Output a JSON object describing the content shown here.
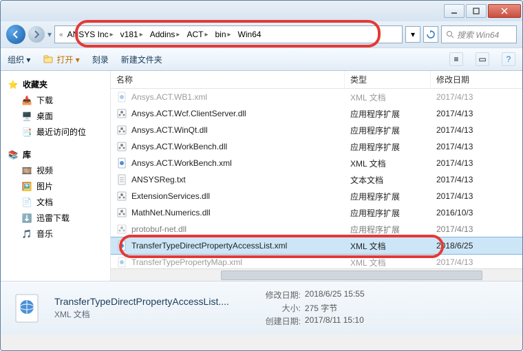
{
  "breadcrumb": {
    "prefix": "«",
    "segments": [
      "ANSYS Inc",
      "v181",
      "Addins",
      "ACT",
      "bin",
      "Win64"
    ]
  },
  "search": {
    "placeholder": "搜索 Win64"
  },
  "toolbar": {
    "organize": "组织 ▾",
    "open": "打开 ▾",
    "burn": "刻录",
    "newfolder": "新建文件夹"
  },
  "sidebar": {
    "favorites": {
      "label": "收藏夹",
      "items": [
        "下载",
        "桌面",
        "最近访问的位"
      ]
    },
    "libraries": {
      "label": "库",
      "items": [
        "视频",
        "图片",
        "文档",
        "迅雷下载",
        "音乐"
      ]
    }
  },
  "columns": {
    "name": "名称",
    "type": "类型",
    "date": "修改日期"
  },
  "files": [
    {
      "icon": "xml",
      "name": "Ansys.ACT.WB1.xml",
      "type": "XML 文档",
      "date": "2017/4/13",
      "dim": true
    },
    {
      "icon": "dll",
      "name": "Ansys.ACT.Wcf.ClientServer.dll",
      "type": "应用程序扩展",
      "date": "2017/4/13"
    },
    {
      "icon": "dll",
      "name": "Ansys.ACT.WinQt.dll",
      "type": "应用程序扩展",
      "date": "2017/4/13"
    },
    {
      "icon": "dll",
      "name": "Ansys.ACT.WorkBench.dll",
      "type": "应用程序扩展",
      "date": "2017/4/13"
    },
    {
      "icon": "xml",
      "name": "Ansys.ACT.WorkBench.xml",
      "type": "XML 文档",
      "date": "2017/4/13"
    },
    {
      "icon": "txt",
      "name": "ANSYSReg.txt",
      "type": "文本文档",
      "date": "2017/4/13"
    },
    {
      "icon": "dll",
      "name": "ExtensionServices.dll",
      "type": "应用程序扩展",
      "date": "2017/4/13"
    },
    {
      "icon": "dll",
      "name": "MathNet.Numerics.dll",
      "type": "应用程序扩展",
      "date": "2016/10/3"
    },
    {
      "icon": "dll",
      "name": "protobuf-net.dll",
      "type": "应用程序扩展",
      "date": "2017/4/13",
      "half": true
    },
    {
      "icon": "xml",
      "name": "TransferTypeDirectPropertyAccessList.xml",
      "type": "XML 文档",
      "date": "2018/6/25",
      "selected": true
    },
    {
      "icon": "xml",
      "name": "TransferTypePropertyMap.xml",
      "type": "XML 文档",
      "date": "2017/4/13",
      "dim": true
    }
  ],
  "details": {
    "title": "TransferTypeDirectPropertyAccessList....",
    "sub": "XML 文档",
    "props": [
      {
        "k": "修改日期:",
        "v": "2018/6/25 15:55"
      },
      {
        "k": "大小:",
        "v": "275 字节"
      },
      {
        "k": "创建日期:",
        "v": "2017/8/11 15:10"
      }
    ]
  }
}
